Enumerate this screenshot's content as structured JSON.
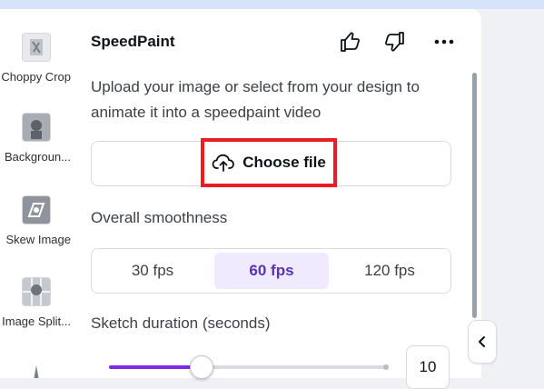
{
  "sidebar": {
    "items": [
      {
        "label": "Choppy Crop",
        "icon": "choppy-crop-thumbnail"
      },
      {
        "label": "Backgroun...",
        "icon": "background-thumbnail"
      },
      {
        "label": "Skew Image",
        "icon": "skew-image-thumbnail"
      },
      {
        "label": "Image Split...",
        "icon": "image-split-thumbnail"
      },
      {
        "label": "",
        "icon": "app-thumbnail"
      }
    ]
  },
  "panel": {
    "title": "SpeedPaint",
    "actions": [
      "thumbs-up-icon",
      "thumbs-down-icon",
      "more-options-icon"
    ],
    "description": "Upload your image or select from your design to animate it into a speedpaint video",
    "upload": {
      "button_label": "Choose file",
      "icon": "cloud-upload-icon"
    },
    "smoothness": {
      "label": "Overall smoothness",
      "options": [
        "30 fps",
        "60 fps",
        "120 fps"
      ],
      "selected": "60 fps"
    },
    "duration": {
      "label": "Sketch duration (seconds)",
      "value": "10",
      "slider_fraction": 0.33
    }
  },
  "colors": {
    "accent": "#7d2ae8",
    "selected_bg": "#efeafe",
    "selected_text": "#5a32b4",
    "highlight": "#ea1c24"
  }
}
